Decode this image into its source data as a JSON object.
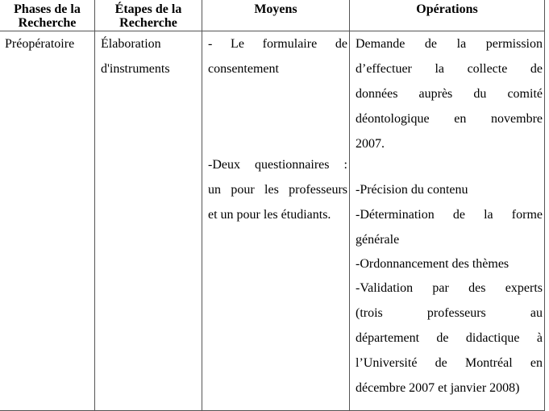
{
  "table": {
    "headers": [
      {
        "line1": "Phases de la",
        "line2": "Recherche"
      },
      {
        "line1": "Étapes de la",
        "line2": "Recherche"
      },
      {
        "line1": "Moyens",
        "line2": ""
      },
      {
        "line1": "Opérations",
        "line2": ""
      }
    ],
    "row": {
      "phase": "Préopératoire",
      "etape": [
        "Élaboration",
        "d'instruments"
      ],
      "moyens": {
        "item1": [
          "- Le formulaire de",
          "consentement"
        ],
        "item2": [
          "-Deux questionnaires :",
          "un pour les professeurs",
          "et un pour les étudiants."
        ]
      },
      "operations": {
        "item1": [
          "Demande de la permission",
          "d’effectuer la collecte de",
          "données auprès du comité",
          "déontologique en novembre",
          "2007."
        ],
        "item2": [
          "-Précision du contenu",
          "-Détermination de la forme",
          "générale",
          "-Ordonnancement des thèmes",
          "-Validation par des experts",
          "(trois professeurs au",
          "département de didactique à",
          "l’Université de Montréal en",
          "décembre 2007 et janvier 2008)"
        ]
      }
    }
  }
}
